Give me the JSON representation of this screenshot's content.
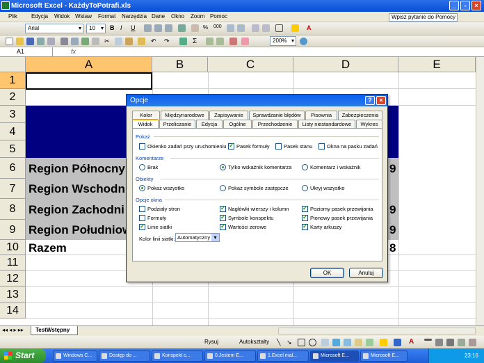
{
  "window": {
    "title": "Microsoft Excel - KażdyToPotrafi.xls"
  },
  "menu": [
    "Plik",
    "Edycja",
    "Widok",
    "Wstaw",
    "Format",
    "Narzędzia",
    "Dane",
    "Okno",
    "Zoom",
    "Pomoc"
  ],
  "help": {
    "placeholder": "Wpisz pytanie do Pomocy"
  },
  "toolbar": {
    "font": "Arial",
    "size": "10",
    "zoom": "200%"
  },
  "formula_bar": {
    "cell": "A1",
    "fx": "fx"
  },
  "columns": [
    "A",
    "B",
    "C",
    "D",
    "E"
  ],
  "rows": [
    "1",
    "2",
    "3",
    "4",
    "5",
    "6",
    "7",
    "8",
    "9",
    "10",
    "11",
    "12",
    "13",
    "14"
  ],
  "cells": {
    "r6": "Region Północny",
    "r7": "Region Wschodni",
    "r8": "Region Zachodni",
    "r9": "Region Południowy",
    "r10": "Razem",
    "d6": "9",
    "d8": "9",
    "d9": "9",
    "d10": "8"
  },
  "sheet_tab": "TestWstępny",
  "drawing": {
    "draw": "Rysuj",
    "autoshapes": "Autokształty"
  },
  "taskbar": {
    "start": "Start",
    "items": [
      "Windows C...",
      "Dostęp do ...",
      "Konspekt c...",
      "0.Jestem E...",
      "1.Excel mal...",
      "Microsoft E...",
      "Microsoft E..."
    ],
    "clock": "23:16"
  },
  "dialog": {
    "title": "Opcje",
    "tabs_row1": [
      "Kolor",
      "Międzynarodowe",
      "Zapisywanie",
      "Sprawdzanie błędów",
      "Pisownia",
      "Zabezpieczenia"
    ],
    "tabs_row2": [
      "Widok",
      "Przeliczanie",
      "Edycja",
      "Ogólne",
      "Przechodzenie",
      "Listy niestandardowe",
      "Wykres"
    ],
    "show": {
      "label": "Pokaż",
      "opts": [
        "Okienko zadań przy uruchomieniu",
        "Pasek formuły",
        "Pasek stanu",
        "Okna na pasku zadań"
      ]
    },
    "comments": {
      "label": "Komentarze",
      "opts": [
        "Brak",
        "Tylko wskaźnik komentarza",
        "Komentarz i wskaźnik"
      ]
    },
    "objects": {
      "label": "Obiekty",
      "opts": [
        "Pokaż wszystko",
        "Pokaż symbole zastępcze",
        "Ukryj wszystko"
      ]
    },
    "window_opts": {
      "label": "Opcje okna",
      "opts": [
        "Podziały stron",
        "Formuły",
        "Linie siatki",
        "Nagłówki wierszy i kolumn",
        "Symbole konspektu",
        "Wartości zerowe",
        "Poziomy pasek przewijania",
        "Pionowy pasek przewijania",
        "Karty arkuszy"
      ]
    },
    "gridcolor": {
      "label": "Kolor linii siatki:",
      "value": "Automatyczny"
    },
    "ok": "OK",
    "cancel": "Anuluj"
  }
}
